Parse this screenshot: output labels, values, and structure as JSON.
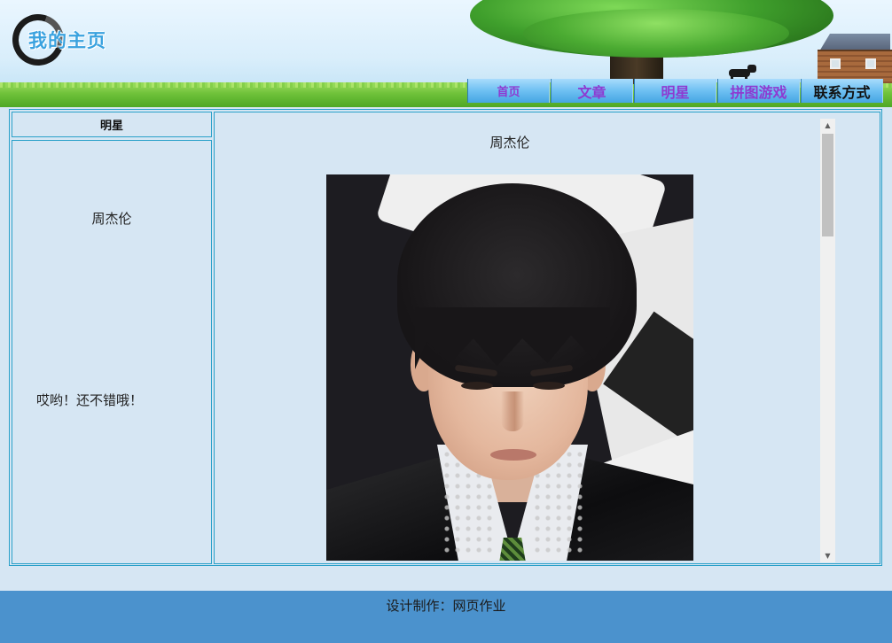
{
  "header": {
    "logo_text": "我的主页"
  },
  "nav": {
    "items": [
      {
        "label": "首页"
      },
      {
        "label": "文章"
      },
      {
        "label": "明星"
      },
      {
        "label": "拼图游戏"
      },
      {
        "label": "联系方式"
      }
    ],
    "active_index": 4,
    "colors": {
      "link": "#8e3ad1",
      "active": "#111111"
    }
  },
  "sidebar": {
    "heading": "明星",
    "star_name": "周杰伦",
    "comment": "哎哟！还不错哦！"
  },
  "content": {
    "title": "周杰伦"
  },
  "footer": {
    "text": "设计制作：网页作业"
  },
  "colors": {
    "page_bg": "#d6e6f3",
    "border": "#2aa0c9",
    "footer_bg": "#4b92cd"
  }
}
